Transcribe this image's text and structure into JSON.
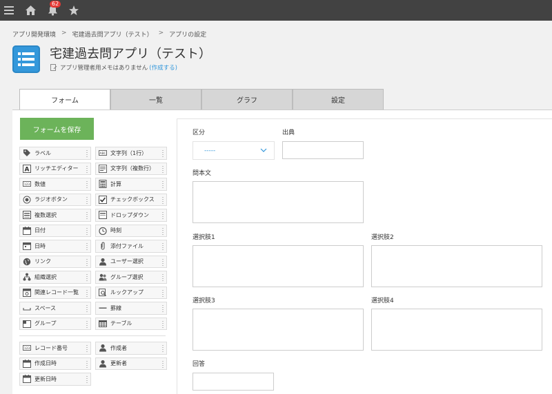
{
  "topbar": {
    "notification_count": "62",
    "icons": [
      "menu-icon",
      "home-icon",
      "bell-icon",
      "star-icon"
    ]
  },
  "breadcrumb": [
    "アプリ開発環境",
    "宅建過去問アプリ（テスト）",
    "アプリの設定"
  ],
  "breadcrumb_separator": ">",
  "app": {
    "title": "宅建過去問アプリ（テスト）",
    "memo_text": "アプリ管理者用メモはありません",
    "memo_link": "(作成する)"
  },
  "tabs": [
    {
      "label": "フォーム",
      "active": true
    },
    {
      "label": "一覧",
      "active": false
    },
    {
      "label": "グラフ",
      "active": false
    },
    {
      "label": "設定",
      "active": false
    }
  ],
  "save_button": "フォームを保存",
  "palette": [
    {
      "label": "ラベル",
      "icon": "tag-icon"
    },
    {
      "label": "文字列（1行）",
      "icon": "text-single-icon"
    },
    {
      "label": "リッチエディター",
      "icon": "rich-editor-icon"
    },
    {
      "label": "文字列（複数行）",
      "icon": "text-multi-icon"
    },
    {
      "label": "数値",
      "icon": "number-icon"
    },
    {
      "label": "計算",
      "icon": "calculator-icon"
    },
    {
      "label": "ラジオボタン",
      "icon": "radio-icon"
    },
    {
      "label": "チェックボックス",
      "icon": "checkbox-icon"
    },
    {
      "label": "複数選択",
      "icon": "multi-select-icon"
    },
    {
      "label": "ドロップダウン",
      "icon": "dropdown-icon"
    },
    {
      "label": "日付",
      "icon": "calendar-icon"
    },
    {
      "label": "時刻",
      "icon": "clock-icon"
    },
    {
      "label": "日時",
      "icon": "datetime-icon"
    },
    {
      "label": "添付ファイル",
      "icon": "paperclip-icon"
    },
    {
      "label": "リンク",
      "icon": "globe-icon"
    },
    {
      "label": "ユーザー選択",
      "icon": "user-icon"
    },
    {
      "label": "組織選択",
      "icon": "org-icon"
    },
    {
      "label": "グループ選択",
      "icon": "group-icon"
    },
    {
      "label": "関連レコード一覧",
      "icon": "related-records-icon"
    },
    {
      "label": "ルックアップ",
      "icon": "lookup-icon"
    },
    {
      "label": "スペース",
      "icon": "space-icon"
    },
    {
      "label": "罫線",
      "icon": "line-icon"
    },
    {
      "label": "グループ",
      "icon": "folder-icon"
    },
    {
      "label": "テーブル",
      "icon": "table-icon"
    }
  ],
  "system_fields": [
    {
      "label": "レコード番号",
      "icon": "record-number-icon"
    },
    {
      "label": "作成者",
      "icon": "user-icon"
    },
    {
      "label": "作成日時",
      "icon": "calendar-icon"
    },
    {
      "label": "更新者",
      "icon": "user-icon"
    },
    {
      "label": "更新日時",
      "icon": "calendar-icon"
    }
  ],
  "form": {
    "kubun_label": "区分",
    "kubun_value": "-----",
    "shutten_label": "出典",
    "question_label": "問本文",
    "choice1_label": "選択肢1",
    "choice2_label": "選択肢2",
    "choice3_label": "選択肢3",
    "choice4_label": "選択肢4",
    "answer_label": "回答"
  },
  "colors": {
    "topbar": "#424242",
    "accent": "#3498db",
    "save_button": "#6cb35a",
    "badge": "#e53935"
  }
}
